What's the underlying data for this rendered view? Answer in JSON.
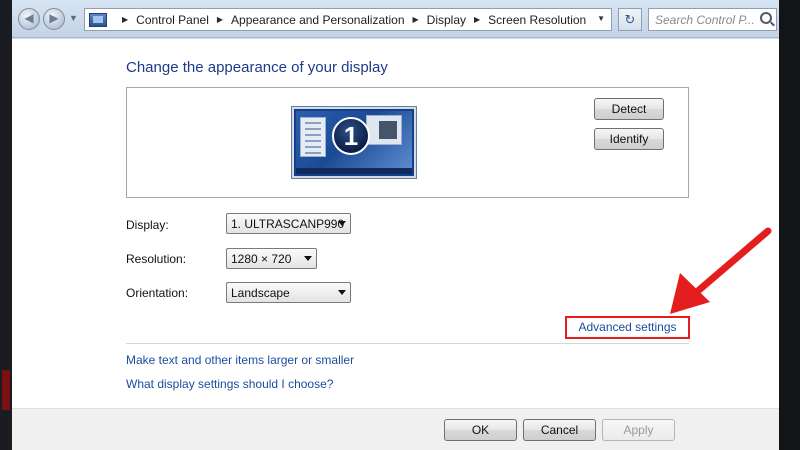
{
  "address_bar": {
    "crumbs": [
      "Control Panel",
      "Appearance and Personalization",
      "Display",
      "Screen Resolution"
    ],
    "search_placeholder": "Search Control P..."
  },
  "heading": "Change the appearance of your display",
  "preview": {
    "monitor_number": "1",
    "detect_label": "Detect",
    "identify_label": "Identify"
  },
  "settings": {
    "display_label": "Display:",
    "display_value": "1. ULTRASCANP990",
    "resolution_label": "Resolution:",
    "resolution_value": "1280 × 720",
    "orientation_label": "Orientation:",
    "orientation_value": "Landscape"
  },
  "links": {
    "advanced_settings": "Advanced settings",
    "make_text_larger": "Make text and other items larger or smaller",
    "which_settings": "What display settings should I choose?"
  },
  "footer": {
    "ok_label": "OK",
    "cancel_label": "Cancel",
    "apply_label": "Apply"
  },
  "colors": {
    "highlight_box": "#e41e1e",
    "annotation_arrow": "#e41e1e",
    "link": "#1a4d9e"
  },
  "icons": [
    "back-arrow-icon",
    "forward-arrow-icon",
    "control-panel-icon",
    "refresh-icon",
    "search-icon",
    "dropdown-arrow-icon"
  ]
}
